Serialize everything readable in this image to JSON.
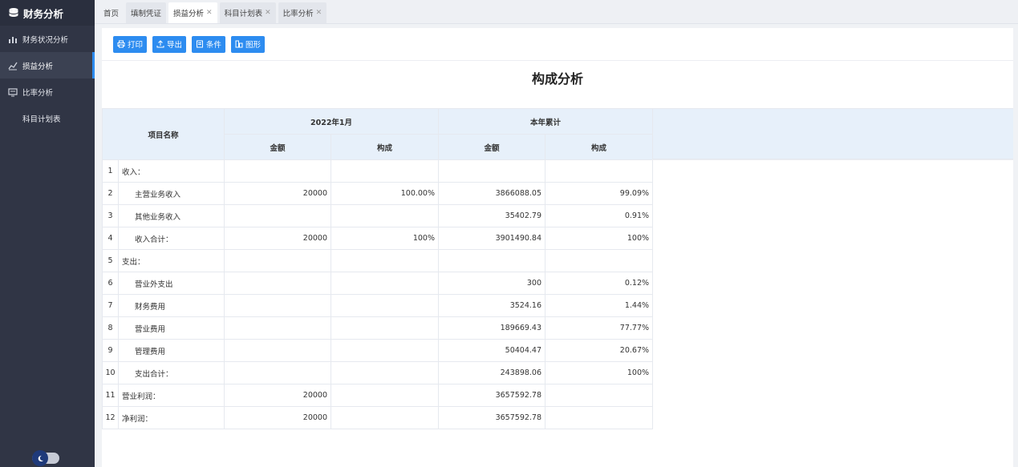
{
  "app": {
    "title": "财务分析"
  },
  "sidebar": {
    "items": [
      {
        "label": "财务状况分析",
        "icon": "bar-chart-icon"
      },
      {
        "label": "损益分析",
        "icon": "line-chart-icon",
        "active": true
      },
      {
        "label": "比率分析",
        "icon": "monitor-icon"
      },
      {
        "label": "科目计划表",
        "icon": ""
      }
    ]
  },
  "tabs": [
    {
      "label": "首页",
      "closable": false
    },
    {
      "label": "填制凭证",
      "closable": false
    },
    {
      "label": "损益分析",
      "closable": true,
      "active": true
    },
    {
      "label": "科目计划表",
      "closable": true
    },
    {
      "label": "比率分析",
      "closable": true
    }
  ],
  "toolbar": {
    "print": "打印",
    "export": "导出",
    "condition": "条件",
    "chart": "图形"
  },
  "report": {
    "title": "构成分析",
    "header": {
      "item_name": "项目名称",
      "period": "2022年1月",
      "ytd": "本年累计",
      "amount": "金额",
      "ratio": "构成"
    },
    "rows": [
      {
        "idx": "1",
        "name": "收入：",
        "sub": false,
        "amt1": "",
        "pct1": "",
        "amt2": "",
        "pct2": ""
      },
      {
        "idx": "2",
        "name": "主营业务收入",
        "sub": true,
        "amt1": "20000",
        "pct1": "100.00%",
        "amt2": "3866088.05",
        "pct2": "99.09%"
      },
      {
        "idx": "3",
        "name": "其他业务收入",
        "sub": true,
        "amt1": "",
        "pct1": "",
        "amt2": "35402.79",
        "pct2": "0.91%"
      },
      {
        "idx": "4",
        "name": "收入合计：",
        "sub": true,
        "amt1": "20000",
        "pct1": "100%",
        "amt2": "3901490.84",
        "pct2": "100%"
      },
      {
        "idx": "5",
        "name": "支出：",
        "sub": false,
        "amt1": "",
        "pct1": "",
        "amt2": "",
        "pct2": ""
      },
      {
        "idx": "6",
        "name": "营业外支出",
        "sub": true,
        "amt1": "",
        "pct1": "",
        "amt2": "300",
        "pct2": "0.12%"
      },
      {
        "idx": "7",
        "name": "财务费用",
        "sub": true,
        "amt1": "",
        "pct1": "",
        "amt2": "3524.16",
        "pct2": "1.44%"
      },
      {
        "idx": "8",
        "name": "营业费用",
        "sub": true,
        "amt1": "",
        "pct1": "",
        "amt2": "189669.43",
        "pct2": "77.77%"
      },
      {
        "idx": "9",
        "name": "管理费用",
        "sub": true,
        "amt1": "",
        "pct1": "",
        "amt2": "50404.47",
        "pct2": "20.67%"
      },
      {
        "idx": "10",
        "name": "支出合计：",
        "sub": true,
        "amt1": "",
        "pct1": "",
        "amt2": "243898.06",
        "pct2": "100%"
      },
      {
        "idx": "11",
        "name": "营业利润：",
        "sub": false,
        "amt1": "20000",
        "pct1": "",
        "amt2": "3657592.78",
        "pct2": ""
      },
      {
        "idx": "12",
        "name": "净利润：",
        "sub": false,
        "amt1": "20000",
        "pct1": "",
        "amt2": "3657592.78",
        "pct2": ""
      }
    ]
  },
  "colors": {
    "accent": "#2d8cf0",
    "sidebar_bg": "#303545",
    "header_bg": "#e7f0fa"
  }
}
